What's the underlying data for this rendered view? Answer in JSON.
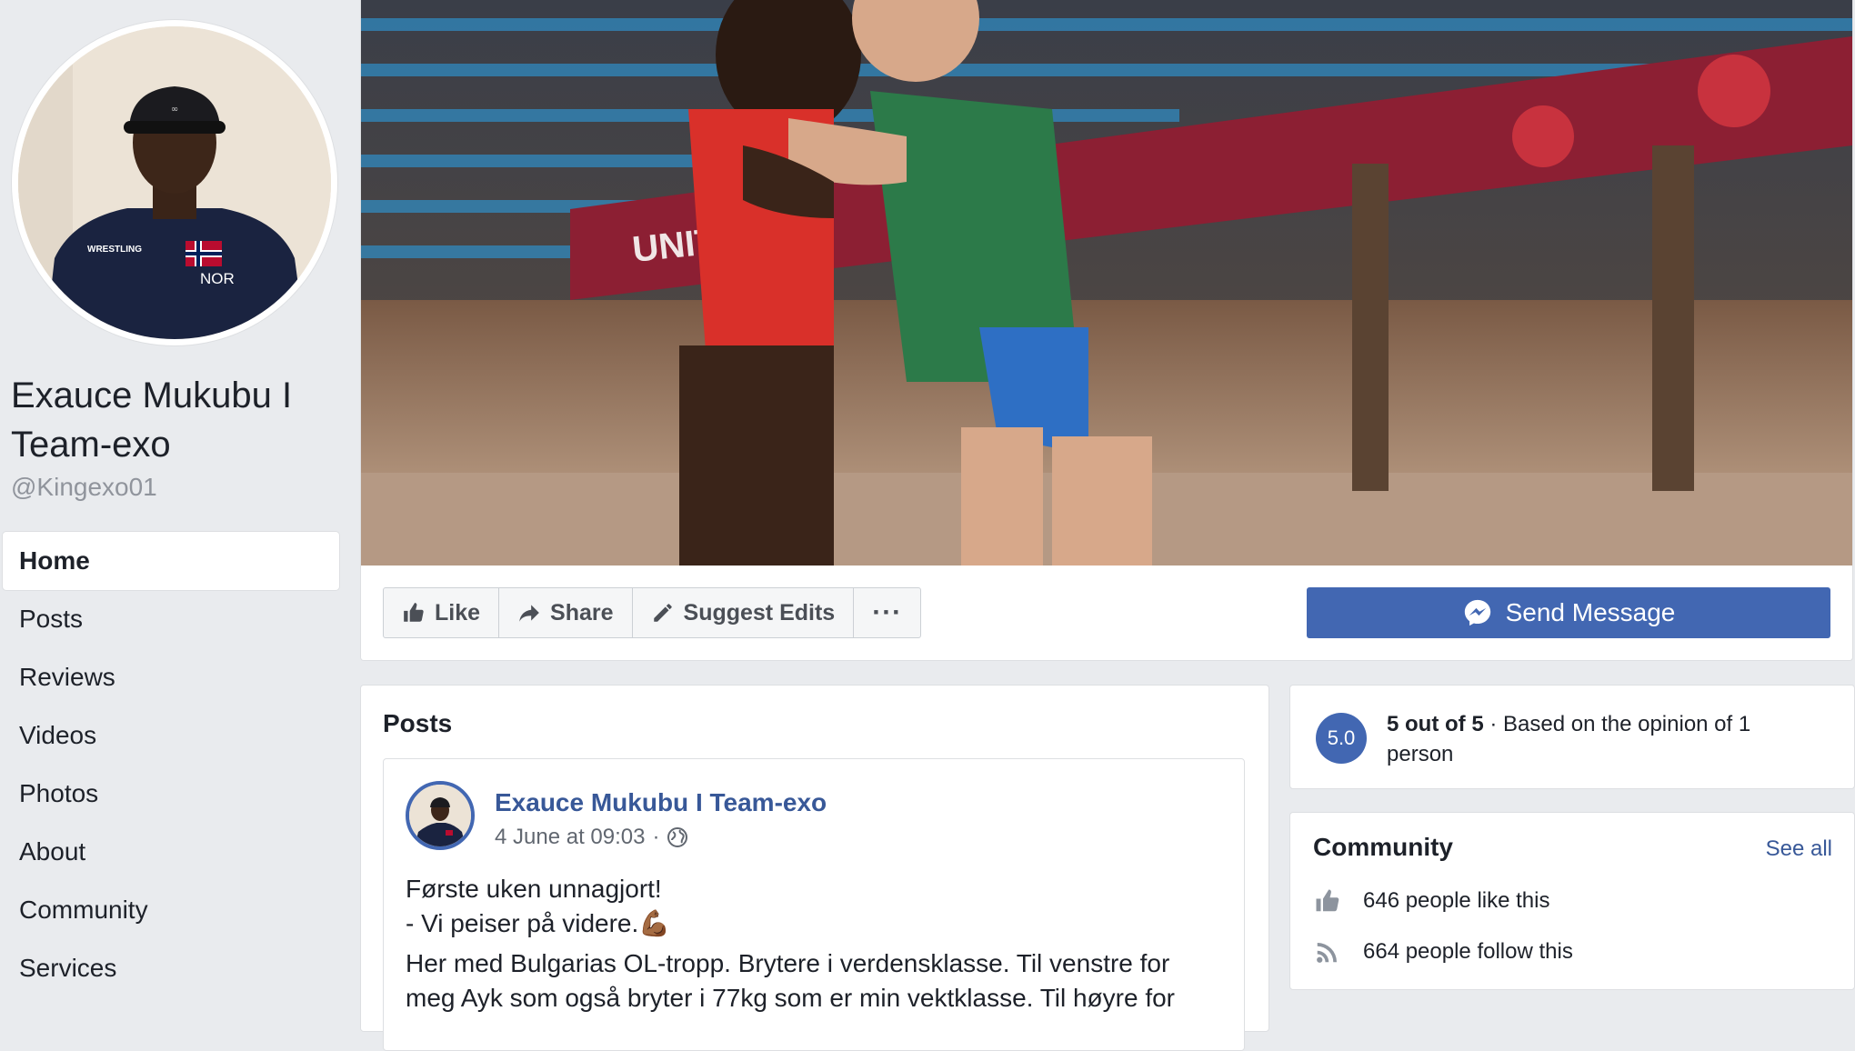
{
  "page": {
    "name": "Exauce Mukubu I Team-exo",
    "handle": "@Kingexo01"
  },
  "nav": {
    "items": [
      {
        "label": "Home",
        "active": true
      },
      {
        "label": "Posts"
      },
      {
        "label": "Reviews"
      },
      {
        "label": "Videos"
      },
      {
        "label": "Photos"
      },
      {
        "label": "About"
      },
      {
        "label": "Community"
      },
      {
        "label": "Services"
      }
    ]
  },
  "actions": {
    "like": "Like",
    "share": "Share",
    "suggest_edits": "Suggest Edits",
    "more": "···",
    "send_message": "Send Message"
  },
  "cover": {
    "banner_text": "UNITED W"
  },
  "avatar": {
    "cap_text": "NOR",
    "shirt_text": "WRESTLING"
  },
  "posts": {
    "title": "Posts",
    "post": {
      "author": "Exauce Mukubu I Team-exo",
      "timestamp": "4 June at 09:03",
      "separator": "·",
      "line1": "Første uken unnagjort!",
      "line2": "- Vi peiser på videre.💪🏾",
      "line3": "Her med Bulgarias OL-tropp. Brytere i verdensklasse. Til venstre for meg Ayk som også bryter i 77kg som er min vektklasse. Til høyre for"
    }
  },
  "rating": {
    "value": "5.0",
    "bold": "5 out of 5",
    "rest": " · Based on the opinion of 1 person"
  },
  "community": {
    "title": "Community",
    "see_all": "See all",
    "likes": "646 people like this",
    "follows": "664 people follow this"
  },
  "colors": {
    "brand": "#4267b2",
    "link": "#385898",
    "background": "#e9ebee"
  }
}
